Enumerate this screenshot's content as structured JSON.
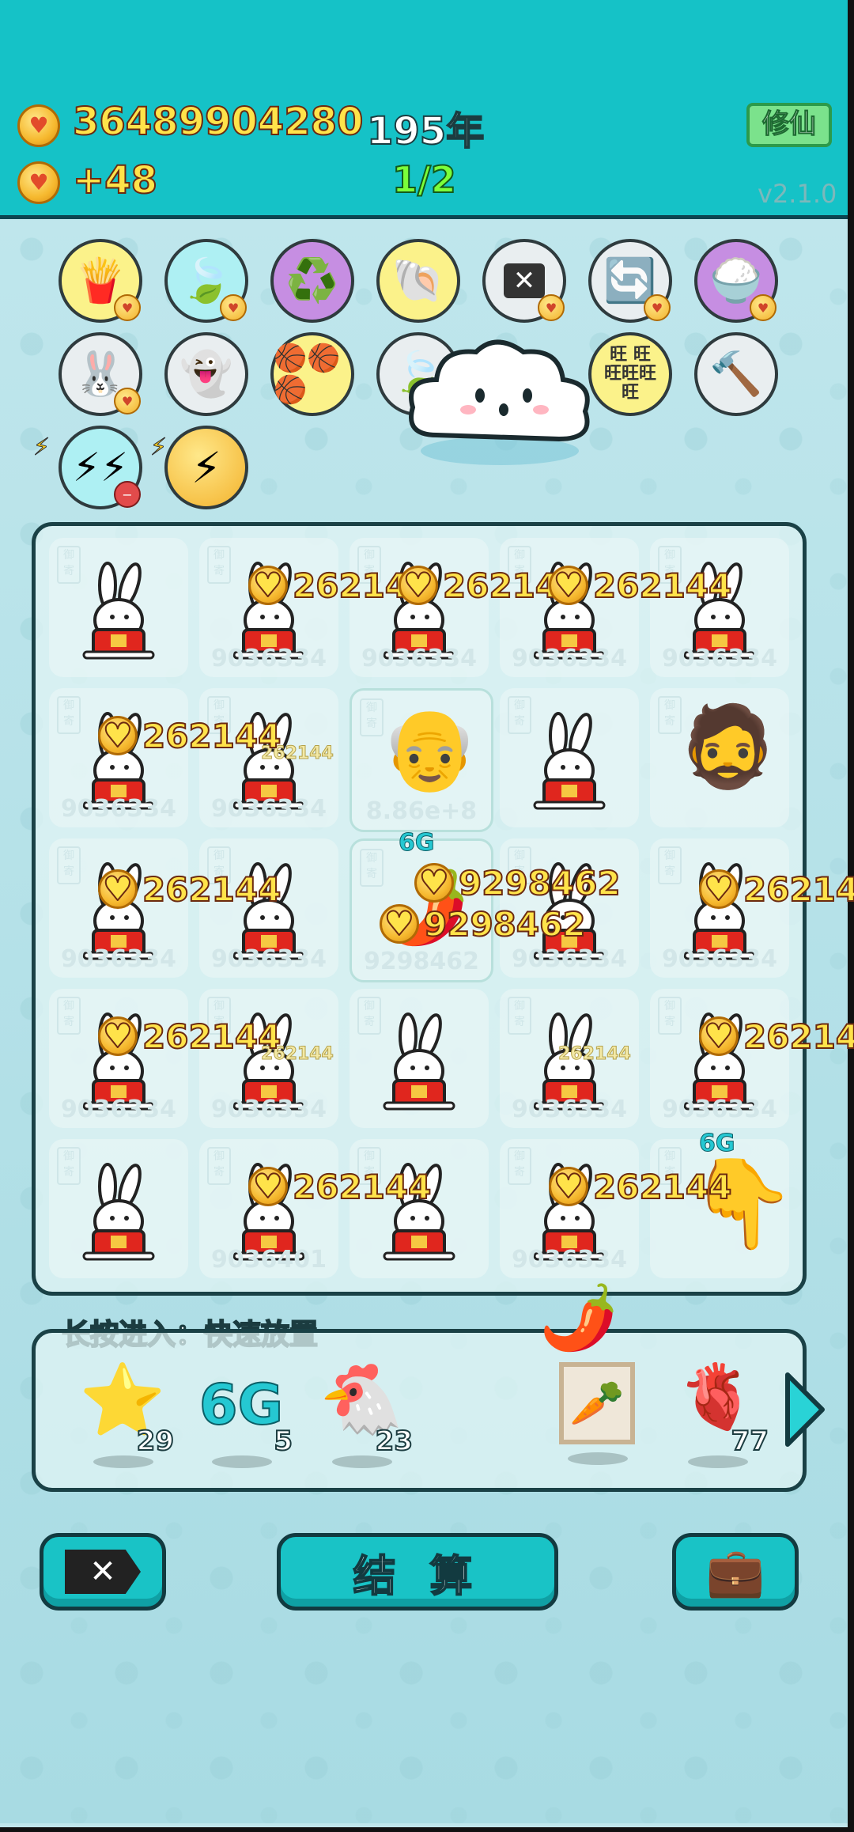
{
  "hud": {
    "coins": "36489904280",
    "income": "+48",
    "year": "195年",
    "page": "1/2",
    "cultivate_button": "修仙",
    "version": "v2.1.0"
  },
  "icons_row1": [
    "fries-icon",
    "leaf-icon",
    "recycle-icon",
    "shell-icon",
    "delete-tag-icon",
    "refresh-icon",
    "rice-bowl-icon"
  ],
  "icons_row2": [
    "bunny-icon",
    "ghost-icon",
    "basketballs-icon",
    "leaf-icon",
    "cloud-mascot",
    "wang-icon",
    "hammer-icon"
  ],
  "grid": {
    "bonus_label": "262144",
    "small_bonus": "262144",
    "cell_value": "9036334",
    "cell_value_alt": "9036401",
    "special_value": "8.86e+8",
    "special_value2": "9298462",
    "big_bonus": "9298462",
    "tag_text": "御寄",
    "sixg": "6G"
  },
  "hint": "长按进入：快速放置",
  "inventory": [
    {
      "name": "star-icon",
      "count": "29"
    },
    {
      "name": "6g-icon",
      "label": "6G",
      "count": "5"
    },
    {
      "name": "chicken-icon",
      "count": "23"
    },
    {
      "name": "carrot-frame-icon",
      "count": ""
    },
    {
      "name": "liver-icon",
      "count": "77"
    }
  ],
  "buttons": {
    "settle": "结 算"
  },
  "colors": {
    "header": "#15c2c7",
    "coin_text": "#ffe34a",
    "button": "#19c3c6"
  }
}
